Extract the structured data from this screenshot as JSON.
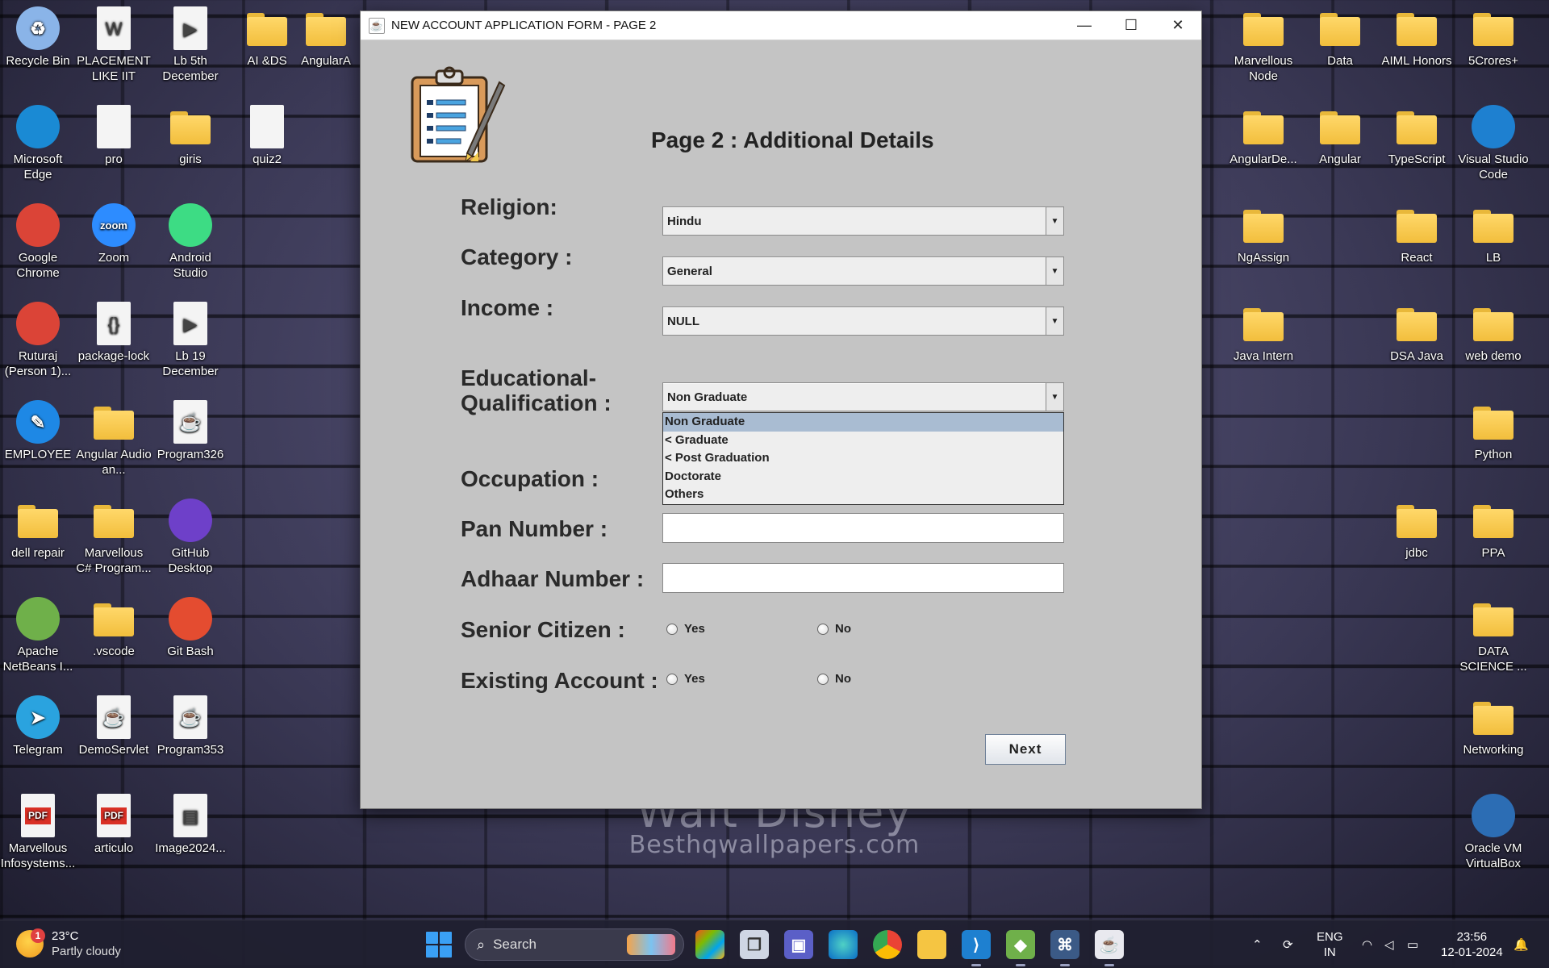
{
  "wallpaper": {
    "title": "Walt Disney",
    "url": "Besthqwallpapers.com"
  },
  "desktop_icons_left": [
    {
      "label": "Recycle Bin",
      "icon": "recycle-bin-icon"
    },
    {
      "label": "PLACEMENT LIKE IIT",
      "icon": "word-doc-icon"
    },
    {
      "label": "Lb 5th December",
      "icon": "video-file-icon"
    },
    {
      "label": "AI &DS",
      "icon": "folder-icon"
    },
    {
      "label": "AngularA",
      "icon": "folder-icon"
    },
    {
      "label": "Microsoft Edge",
      "icon": "edge-icon"
    },
    {
      "label": "pro",
      "icon": "doc-icon"
    },
    {
      "label": "giris",
      "icon": "folder-icon"
    },
    {
      "label": "quiz2",
      "icon": "blank-file-icon"
    },
    {
      "label": "Google Chrome",
      "icon": "chrome-icon"
    },
    {
      "label": "Zoom",
      "icon": "zoom-icon"
    },
    {
      "label": "Android Studio",
      "icon": "android-studio-icon"
    },
    {
      "label": "Ruturaj (Person 1)...",
      "icon": "chrome-profile-icon"
    },
    {
      "label": "package-lock",
      "icon": "json-file-icon"
    },
    {
      "label": "Lb 19 December",
      "icon": "video-file-icon"
    },
    {
      "label": "EMPLOYEE",
      "icon": "tool-icon"
    },
    {
      "label": "Angular Audio an...",
      "icon": "folder-icon"
    },
    {
      "label": "Program326",
      "icon": "java-file-icon"
    },
    {
      "label": "dell repair",
      "icon": "folder-icon"
    },
    {
      "label": "Marvellous C# Program...",
      "icon": "folder-icon"
    },
    {
      "label": "GitHub Desktop",
      "icon": "github-icon"
    },
    {
      "label": "Apache NetBeans I...",
      "icon": "netbeans-icon"
    },
    {
      "label": ".vscode",
      "icon": "folder-icon"
    },
    {
      "label": "Git Bash",
      "icon": "git-bash-icon"
    },
    {
      "label": "Telegram",
      "icon": "telegram-icon"
    },
    {
      "label": "DemoServlet",
      "icon": "java-file-icon"
    },
    {
      "label": "Program353",
      "icon": "java-file-icon"
    },
    {
      "label": "Marvellous Infosystems...",
      "icon": "pdf-icon"
    },
    {
      "label": "articulo",
      "icon": "pdf-icon"
    },
    {
      "label": "Image2024...",
      "icon": "image-file-icon"
    }
  ],
  "desktop_icons_right": [
    {
      "label": "Marvellous Node",
      "icon": "folder-icon"
    },
    {
      "label": "Data",
      "icon": "folder-icon"
    },
    {
      "label": "AIML Honors",
      "icon": "folder-icon"
    },
    {
      "label": "5Crores+",
      "icon": "folder-icon"
    },
    {
      "label": "AngularDe...",
      "icon": "folder-icon"
    },
    {
      "label": "Angular",
      "icon": "folder-icon"
    },
    {
      "label": "TypeScript",
      "icon": "folder-icon"
    },
    {
      "label": "Visual Studio Code",
      "icon": "vscode-icon"
    },
    {
      "label": "NgAssign",
      "icon": "folder-icon"
    },
    {
      "label": "React",
      "icon": "folder-icon"
    },
    {
      "label": "LB",
      "icon": "folder-icon"
    },
    {
      "label": "Java Intern",
      "icon": "folder-icon"
    },
    {
      "label": "DSA Java",
      "icon": "folder-icon"
    },
    {
      "label": "web demo",
      "icon": "folder-icon"
    },
    {
      "label": "Python",
      "icon": "folder-icon"
    },
    {
      "label": "jdbc",
      "icon": "folder-icon"
    },
    {
      "label": "PPA",
      "icon": "folder-icon"
    },
    {
      "label": "DATA SCIENCE ...",
      "icon": "folder-icon"
    },
    {
      "label": "Networking",
      "icon": "folder-icon"
    },
    {
      "label": "Oracle VM VirtualBox",
      "icon": "virtualbox-icon"
    }
  ],
  "window": {
    "title": "NEW ACCOUNT APPLICATION FORM - PAGE 2",
    "controls": {
      "minimize": "—",
      "maximize": "☐",
      "close": "✕"
    },
    "heading": "Page 2 : Additional Details",
    "fields": {
      "religion": {
        "label": "Religion:",
        "value": "Hindu"
      },
      "category": {
        "label": "Category :",
        "value": "General"
      },
      "income": {
        "label": "Income :",
        "value": "NULL"
      },
      "education": {
        "label_line1": "Educational-",
        "label_line2": "Qualification :",
        "value": "Non Graduate"
      },
      "occupation": {
        "label": "Occupation :"
      },
      "pan": {
        "label": "Pan Number :",
        "value": ""
      },
      "adhaar": {
        "label": "Adhaar Number :",
        "value": ""
      },
      "senior": {
        "label": "Senior Citizen :",
        "yes": "Yes",
        "no": "No"
      },
      "existing": {
        "label": "Existing Account :",
        "yes": "Yes",
        "no": "No"
      }
    },
    "education_options": [
      "Non Graduate",
      "< Graduate",
      "< Post Graduation",
      "Doctorate",
      "Others"
    ],
    "education_selected_index": 0,
    "next_label": "Next"
  },
  "taskbar": {
    "weather_badge": "1",
    "temperature": "23°C",
    "condition": "Partly cloudy",
    "search_placeholder": "Search",
    "lang_line1": "ENG",
    "lang_line2": "IN",
    "time": "23:56",
    "date": "12-01-2024"
  },
  "colors": {
    "window_bg": "#c4c4c4",
    "dropdown_selection": "#a9bcd2",
    "taskbar_bg": "#202030"
  }
}
